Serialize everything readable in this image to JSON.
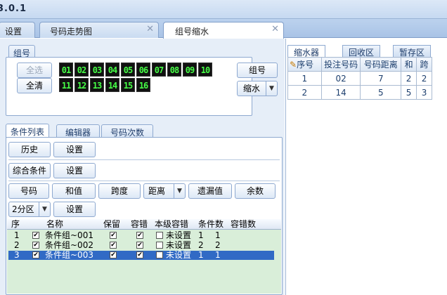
{
  "window": {
    "title": "3.0.1"
  },
  "tabs": [
    {
      "label": "设置"
    },
    {
      "label": "号码走势图"
    },
    {
      "label": "组号缩水"
    }
  ],
  "group": {
    "title": "组号",
    "select_all": "全选",
    "clear_all": "全清",
    "numbers": [
      "01",
      "02",
      "03",
      "04",
      "05",
      "06",
      "07",
      "08",
      "09",
      "10",
      "11",
      "12",
      "13",
      "14",
      "15",
      "16"
    ],
    "group_button": "组号",
    "shrink_select": "缩水"
  },
  "condition_tabs": [
    "条件列表",
    "编辑器",
    "号码次数"
  ],
  "buttons": {
    "history": "历史",
    "settings": "设置",
    "combined": "综合条件",
    "number": "号码",
    "sum": "和值",
    "span": "跨度",
    "distance": "距离",
    "missing": "遗漏值",
    "remainder": "余数",
    "partition": "2分区"
  },
  "condition_table": {
    "headers": [
      "序",
      "",
      "名称",
      "保留",
      "容错",
      "本级容错",
      "条件数",
      "容错数"
    ],
    "rows": [
      {
        "idx": "1",
        "name": "条件组~001",
        "level": "未设置",
        "count": "1",
        "errors": "1",
        "selected": false
      },
      {
        "idx": "2",
        "name": "条件组~002",
        "level": "未设置",
        "count": "2",
        "errors": "2",
        "selected": false
      },
      {
        "idx": "3",
        "name": "条件组~003",
        "level": "未设置",
        "count": "1",
        "errors": "1",
        "selected": true
      }
    ]
  },
  "right_tabs": [
    "缩水器",
    "回收区",
    "暂存区"
  ],
  "result_table": {
    "headers": [
      "序号",
      "投注号码",
      "号码距离",
      "和",
      "跨"
    ],
    "rows": [
      [
        "1",
        "02",
        "7",
        "2",
        "2"
      ],
      [
        "2",
        "14",
        "5",
        "5",
        "3"
      ]
    ]
  }
}
